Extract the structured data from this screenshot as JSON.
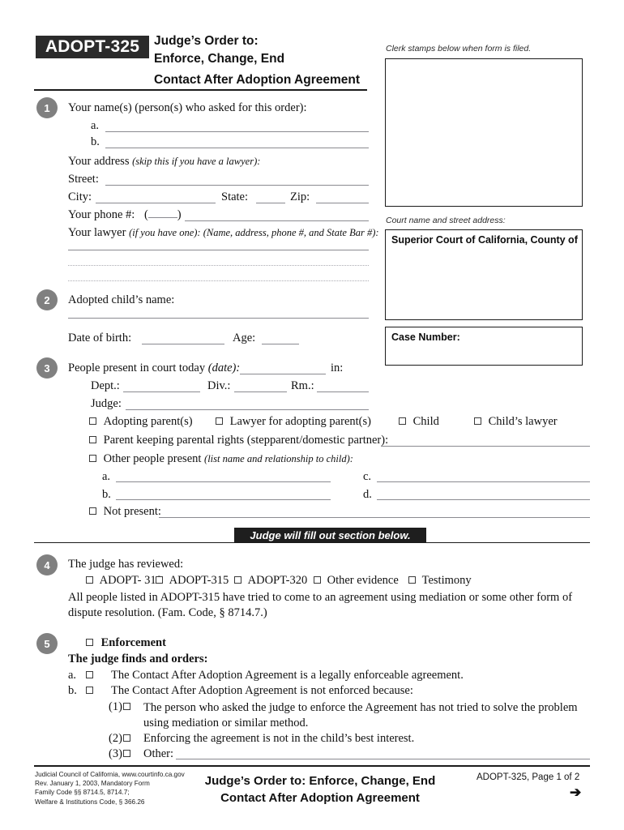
{
  "form": {
    "code": "ADOPT-325",
    "title_lines": [
      "Judge’s Order to:",
      "Enforce, Change, End",
      "Contact After Adoption Agreement"
    ]
  },
  "right_column": {
    "clerk_caption": "Clerk stamps below when form is filed.",
    "court_caption": "Court name and street address:",
    "court_label": "Superior Court of California, County of",
    "case_label": "Case Number:"
  },
  "section1": {
    "number": "1",
    "heading": "Your name(s) (person(s) who asked for this order):",
    "item_a": "a.",
    "item_b": "b.",
    "address_label": "Your address",
    "address_note": "(skip this if you have a lawyer):",
    "street_label": "Street:",
    "city_label": "City:",
    "state_label": "State:",
    "zip_label": "Zip:",
    "phone_label": "Your phone #:",
    "phone_paren_open": "(",
    "phone_paren_close": ")",
    "lawyer_label": "Your lawyer",
    "lawyer_note": "(if you have one): (Name, address, phone #, and State Bar #):"
  },
  "section2": {
    "number": "2",
    "heading": "Adopted child’s name:",
    "dob_label": "Date of birth:",
    "age_label": "Age:"
  },
  "section3": {
    "number": "3",
    "heading": "People present in court today",
    "heading_note": "(date):",
    "heading_tail": "in:",
    "dept_label": "Dept.:",
    "div_label": "Div.:",
    "rm_label": "Rm.:",
    "judge_label": "Judge:",
    "checkboxes_row1": [
      "Adopting parent(s)",
      "Lawyer for adopting parent(s)",
      "Child",
      "Child’s lawyer"
    ],
    "parent_keeping": "Parent keeping parental rights (stepparent/domestic partner):",
    "other_people": "Other people present",
    "other_people_note": "(list name and relationship to child):",
    "sub_a": "a.",
    "sub_b": "b.",
    "sub_c": "c.",
    "sub_d": "d.",
    "not_present": "Not present:"
  },
  "judge_banner": "Judge will fill out section below.",
  "section4": {
    "number": "4",
    "heading": "The judge has reviewed:",
    "checkboxes": [
      "ADOPT- 310",
      "ADOPT-315",
      "ADOPT-320",
      "Other evidence",
      "Testimony"
    ],
    "paragraph": "All people listed in ADOPT-315 have tried to come to an agreement using mediation or some other form of dispute resolution. (Fam. Code, § 8714.7.)"
  },
  "section5": {
    "number": "5",
    "title": "Enforcement",
    "subtitle": "The judge finds and orders:",
    "item_a_label": "a.",
    "item_a_text": "The Contact After Adoption Agreement is a legally enforceable agreement.",
    "item_b_label": "b.",
    "item_b_text": "The Contact After Adoption Agreement is not enforced because:",
    "sub1_label": "(1)",
    "sub1_text": "The person who asked the judge to enforce the Agreement has not tried to solve the problem using mediation or similar method.",
    "sub2_label": "(2)",
    "sub2_text": "Enforcing the agreement is not in the child’s best interest.",
    "sub3_label": "(3)",
    "sub3_text": "Other:"
  },
  "footer": {
    "left_lines": [
      "Judicial Council of California, www.courtinfo.ca.gov",
      "Rev. January 1, 2003, Mandatory Form",
      "Family Code §§ 8714.5, 8714.7;",
      "Welfare & Institutions Code, § 366.26"
    ],
    "center_line1": "Judge’s Order to: Enforce, Change, End",
    "center_line2": "Contact After Adoption Agreement",
    "right": "ADOPT-325, Page 1 of 2",
    "arrow": "➔"
  },
  "colors": {
    "badge_bg": "#2b2b2b",
    "circle_bg": "#808080",
    "banner_bg": "#1e1e1e",
    "rule": "#8a8a90"
  }
}
